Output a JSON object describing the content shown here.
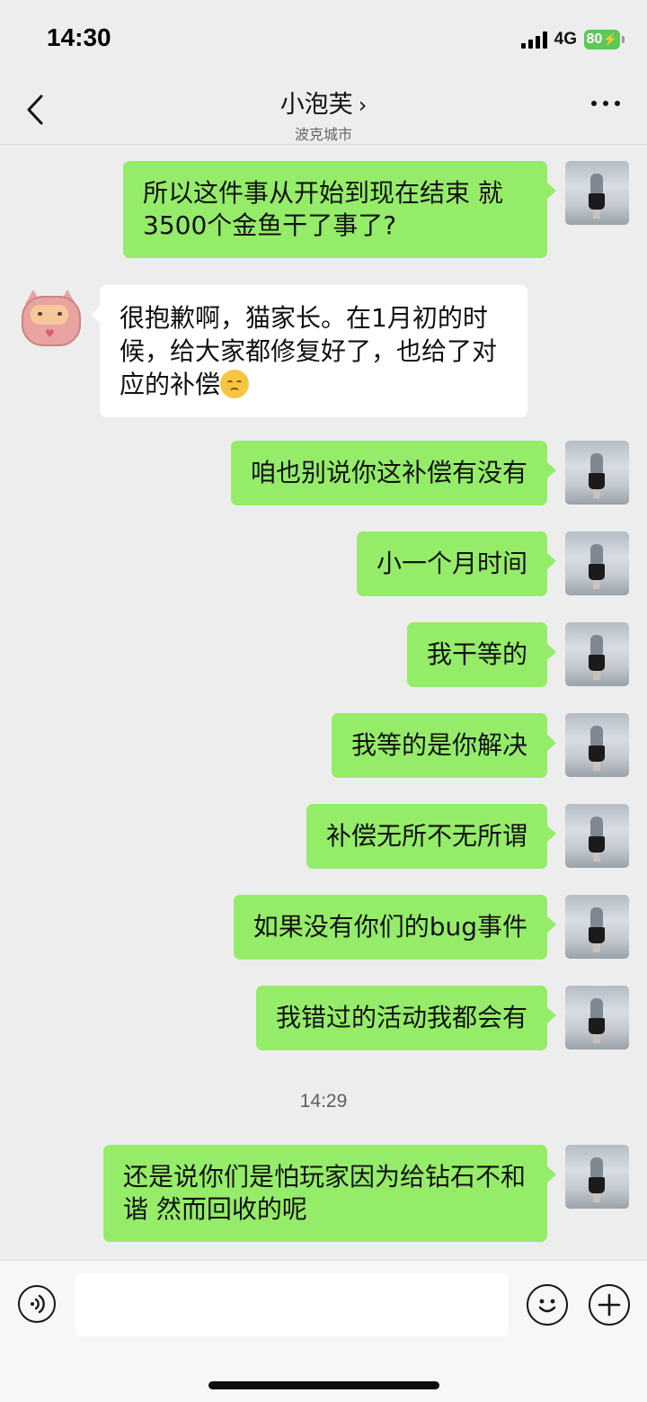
{
  "status_bar": {
    "time": "14:30",
    "network": "4G",
    "battery": "80"
  },
  "header": {
    "title": "小泡芙",
    "subtitle": "波克城市"
  },
  "messages": [
    {
      "side": "right",
      "text": "所以这件事从开始到现在结束 就3500个金鱼干了事了?"
    },
    {
      "side": "left",
      "text": "很抱歉啊，猫家长。在1月初的时候，给大家都修复好了，也给了对应的补偿"
    },
    {
      "side": "right",
      "text": "咱也别说你这补偿有没有"
    },
    {
      "side": "right",
      "text": "小一个月时间"
    },
    {
      "side": "right",
      "text": "我干等的"
    },
    {
      "side": "right",
      "text": "我等的是你解决"
    },
    {
      "side": "right",
      "text": "补偿无所不无所谓"
    },
    {
      "side": "right",
      "text": "如果没有你们的bug事件"
    },
    {
      "side": "right",
      "text": "我错过的活动我都会有"
    },
    {
      "side": "right",
      "text": "还是说你们是怕玩家因为给钻石不和谐 然而回收的呢"
    }
  ],
  "timestamp": "14:29",
  "input": {
    "value": ""
  },
  "colors": {
    "sent_bubble": "#95ec69",
    "received_bubble": "#ffffff",
    "background": "#ededed"
  }
}
